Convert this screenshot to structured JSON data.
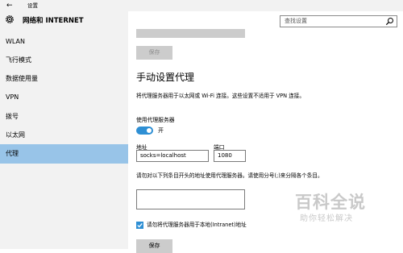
{
  "window": {
    "title": "设置",
    "back_glyph": "←"
  },
  "sidebar": {
    "header": "网络和 INTERNET",
    "items": [
      {
        "label": "WLAN"
      },
      {
        "label": "飞行模式"
      },
      {
        "label": "数据使用量"
      },
      {
        "label": "VPN"
      },
      {
        "label": "拨号"
      },
      {
        "label": "以太网"
      },
      {
        "label": "代理",
        "active": true
      }
    ]
  },
  "search": {
    "placeholder": "查找设置"
  },
  "auto_section": {
    "save_label": "保存"
  },
  "manual": {
    "heading": "手动设置代理",
    "description": "将代理服务器用于以太网或 Wi-Fi 连接。这些设置不适用于 VPN 连接。",
    "use_proxy_label": "使用代理服务器",
    "toggle_state": "开",
    "address_label": "地址",
    "address_value": "socks=localhost",
    "port_label": "端口",
    "port_value": "1080",
    "exceptions_desc": "请勿对以下列条目开头的地址使用代理服务器。请使用分号(;)来分隔各个条目。",
    "exceptions_value": "",
    "local_bypass_label": "请勿将代理服务器用于本地(Intranet)地址",
    "local_bypass_checked": true,
    "save_label": "保存"
  },
  "watermark": {
    "title": "百科全说",
    "subtitle": "助你轻松解决"
  },
  "colors": {
    "accent": "#2e8fd4",
    "selected": "#98c4e8",
    "sidebar_bg": "#f2f2f2"
  }
}
